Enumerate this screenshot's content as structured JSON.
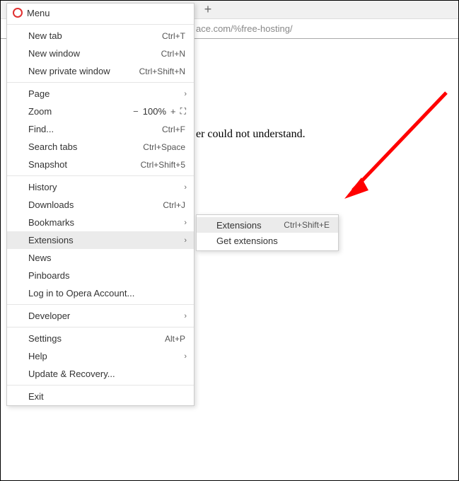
{
  "chrome": {
    "new_tab_glyph": "+",
    "url": "ace.com/%free-hosting/"
  },
  "page": {
    "error_fragment": "er could not understand."
  },
  "menu": {
    "title": "Menu",
    "items": [
      {
        "label": "New tab",
        "shortcut": "Ctrl+T"
      },
      {
        "label": "New window",
        "shortcut": "Ctrl+N"
      },
      {
        "label": "New private window",
        "shortcut": "Ctrl+Shift+N"
      }
    ],
    "page_label": "Page",
    "zoom": {
      "label": "Zoom",
      "minus": "−",
      "value": "100%",
      "plus": "+",
      "expand_glyph": "⛶"
    },
    "find": {
      "label": "Find...",
      "shortcut": "Ctrl+F"
    },
    "search_tabs": {
      "label": "Search tabs",
      "shortcut": "Ctrl+Space"
    },
    "snapshot": {
      "label": "Snapshot",
      "shortcut": "Ctrl+Shift+5"
    },
    "history": {
      "label": "History"
    },
    "downloads": {
      "label": "Downloads",
      "shortcut": "Ctrl+J"
    },
    "bookmarks": {
      "label": "Bookmarks"
    },
    "extensions": {
      "label": "Extensions"
    },
    "news": {
      "label": "News"
    },
    "pinboards": {
      "label": "Pinboards"
    },
    "login": {
      "label": "Log in to Opera Account..."
    },
    "developer": {
      "label": "Developer"
    },
    "settings": {
      "label": "Settings",
      "shortcut": "Alt+P"
    },
    "help": {
      "label": "Help"
    },
    "update": {
      "label": "Update & Recovery..."
    },
    "exit": {
      "label": "Exit"
    },
    "chevron_glyph": "›"
  },
  "submenu": {
    "extensions": {
      "label": "Extensions",
      "shortcut": "Ctrl+Shift+E"
    },
    "get": {
      "label": "Get extensions"
    }
  },
  "colors": {
    "arrow": "#ff0000"
  }
}
